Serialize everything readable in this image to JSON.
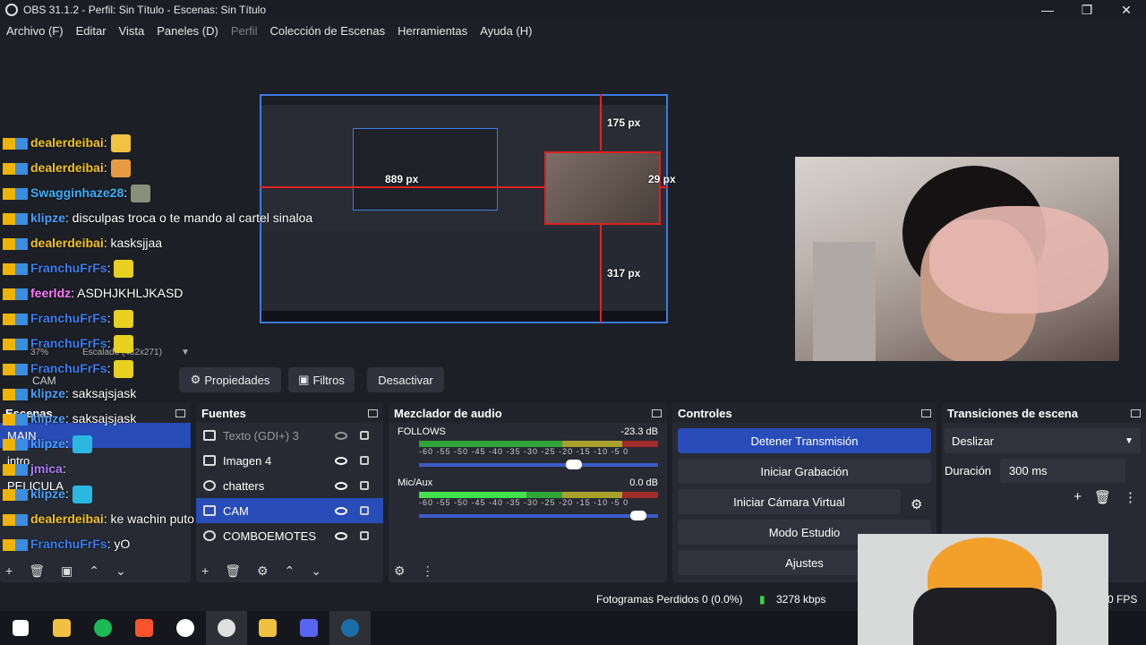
{
  "window": {
    "title": "OBS 31.1.2 - Perfil: Sin Título - Escenas: Sin Título"
  },
  "menu": [
    "Archivo (F)",
    "Editar",
    "Vista",
    "Paneles (D)",
    "Perfil",
    "Colección de Escenas",
    "Herramientas",
    "Ayuda (H)"
  ],
  "preview": {
    "labels": {
      "top": "175 px",
      "left": "889 px",
      "right": "29 px",
      "bottom": "317 px"
    },
    "zoom": "37%",
    "scale_label": "Escalado (482x271)"
  },
  "source_toolbar": {
    "selected_source": "CAM",
    "properties": "Propiedades",
    "filters": "Filtros",
    "deactivate": "Desactivar"
  },
  "chat": [
    {
      "user": "dealerdeibai",
      "color": "#f5c518",
      "msg": ":",
      "emote": "#f2c240"
    },
    {
      "user": "dealerdeibai",
      "color": "#f5c518",
      "msg": ":",
      "emote": "#e89a40"
    },
    {
      "user": "Swagginhaze28",
      "color": "#3ab0ff",
      "msg": ":",
      "emote": "#8a8f7a"
    },
    {
      "user": "klipze",
      "color": "#4aa3ff",
      "msg": ": disculpas troca o te mando al cartel sinaloa"
    },
    {
      "user": "dealerdeibai",
      "color": "#f5c518",
      "msg": ": kasksjjaa"
    },
    {
      "user": "FranchuFrFs",
      "color": "#3a7df0",
      "msg": ":",
      "emote": "#e8d020"
    },
    {
      "user": "feerldz",
      "color": "#ff7aff",
      "msg": ": ASDHJKHLJKASD"
    },
    {
      "user": "FranchuFrFs",
      "color": "#3a7df0",
      "msg": ":",
      "emote": "#e8d020"
    },
    {
      "user": "FranchuFrFs",
      "color": "#3a7df0",
      "msg": ":",
      "emote": "#e8d020"
    },
    {
      "user": "FranchuFrFs",
      "color": "#3a7df0",
      "msg": ":",
      "emote": "#e8d020"
    },
    {
      "user": "klipze",
      "color": "#4aa3ff",
      "msg": ": saksajsjask"
    },
    {
      "user": "klipze",
      "color": "#4aa3ff",
      "msg": ": saksajsjask"
    },
    {
      "user": "klipze",
      "color": "#4aa3ff",
      "msg": ":",
      "emote": "#2ab8e0"
    },
    {
      "user": "jmica",
      "color": "#b17bff",
      "msg": ":"
    },
    {
      "user": "klipze",
      "color": "#4aa3ff",
      "msg": ":",
      "emote": "#2ab8e0"
    },
    {
      "user": "dealerdeibai",
      "color": "#f5c518",
      "msg": ": ke wachin puto"
    },
    {
      "user": "FranchuFrFs",
      "color": "#3a7df0",
      "msg": ": yO"
    }
  ],
  "scenes": {
    "title": "Escenas",
    "items": [
      "MAIN",
      "intro",
      "PELICULA"
    ]
  },
  "sources": {
    "title": "Fuentes",
    "items": [
      {
        "name": "Texto (GDI+) 3",
        "hidden": true
      },
      {
        "name": "Imagen 4",
        "hidden": false
      },
      {
        "name": "chatters",
        "hidden": false
      },
      {
        "name": "CAM",
        "hidden": false,
        "selected": true
      },
      {
        "name": "COMBOEMOTES",
        "hidden": false
      }
    ]
  },
  "mixer": {
    "title": "Mezclador de audio",
    "tracks": [
      {
        "name": "FOLLOWS",
        "db": "-23.3 dB",
        "level": 0.68
      },
      {
        "name": "Mic/Aux",
        "db": "0.0 dB",
        "level": 0.95
      }
    ],
    "scale": "-60 -55 -50 -45 -40 -35 -30 -25 -20 -15 -10 -5 0"
  },
  "controls": {
    "title": "Controles",
    "buttons": [
      "Detener Transmisión",
      "Iniciar Grabación",
      "Iniciar Cámara Virtual",
      "Modo Estudio",
      "Ajustes"
    ]
  },
  "transitions": {
    "title": "Transiciones de escena",
    "selected": "Deslizar",
    "duration_label": "Duración",
    "duration_value": "300 ms"
  },
  "status": {
    "dropped": "Fotogramas Perdidos 0 (0.0%)",
    "bitrate": "3278 kbps",
    "fps": "0 FPS"
  },
  "colors": {
    "accent": "#284cb8",
    "bg": "#1d1f26",
    "panel": "#272a33",
    "red_guides": "#e42222"
  }
}
